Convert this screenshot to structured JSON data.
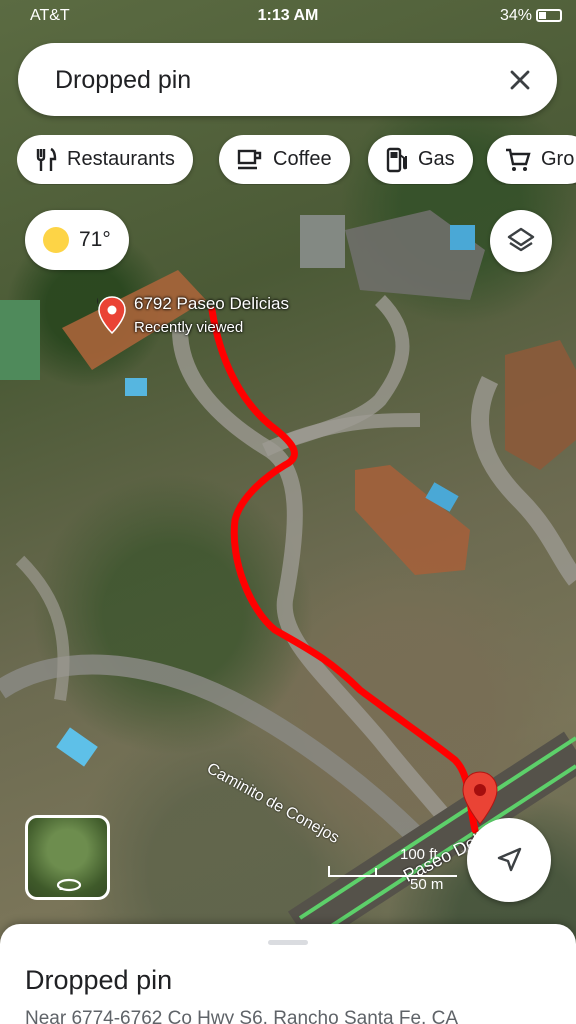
{
  "status_bar": {
    "carrier": "AT&T",
    "time": "1:13 AM",
    "battery": "34%"
  },
  "search": {
    "value": "Dropped pin"
  },
  "chips": [
    {
      "label": "Restaurants",
      "icon": "fork-knife-icon"
    },
    {
      "label": "Coffee",
      "icon": "coffee-cup-icon"
    },
    {
      "label": "Gas",
      "icon": "gas-pump-icon"
    },
    {
      "label": "Gro",
      "icon": "cart-icon"
    }
  ],
  "weather": {
    "temperature": "71°"
  },
  "map": {
    "place_name": "6792 Paseo Delicias",
    "place_sub": "Recently viewed",
    "road_1": "Caminito de Conejos",
    "road_2": "Paseo Delicias",
    "scale_ft": "100 ft",
    "scale_m": "50 m",
    "route_color": "#ff0000",
    "pin_color": "#ea4335"
  },
  "sheet": {
    "title": "Dropped pin",
    "address": "Near 6774-6762 Co Hwy S6, Rancho Santa Fe, CA"
  }
}
